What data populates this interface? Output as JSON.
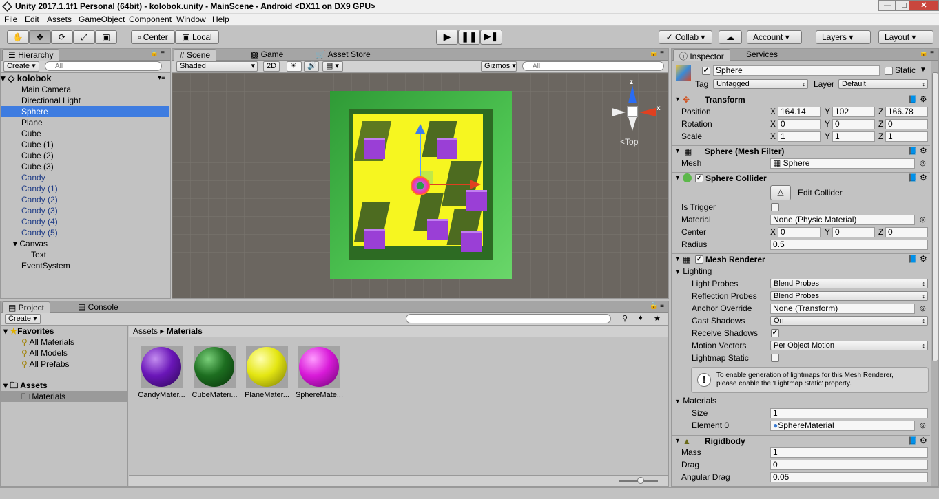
{
  "window": {
    "title": "Unity 2017.1.1f1 Personal (64bit) - kolobok.unity - MainScene - Android <DX11 on DX9 GPU>"
  },
  "menu": [
    "File",
    "Edit",
    "Assets",
    "GameObject",
    "Component",
    "Window",
    "Help"
  ],
  "toolbar": {
    "pivot": "Center",
    "space": "Local",
    "collab": "Collab",
    "account": "Account",
    "layers": "Layers",
    "layout": "Layout"
  },
  "hierarchy": {
    "tab": "Hierarchy",
    "create": "Create",
    "search_placeholder": "All",
    "scene": "kolobok",
    "items": [
      "Main Camera",
      "Directional Light",
      "Sphere",
      "Plane",
      "Cube",
      "Cube (1)",
      "Cube (2)",
      "Cube (3)",
      "Candy",
      "Candy (1)",
      "Candy (2)",
      "Candy (3)",
      "Candy (4)",
      "Candy (5)",
      "Canvas",
      "Text",
      "EventSystem"
    ]
  },
  "scene_view": {
    "tabs": [
      "Scene",
      "Game",
      "Asset Store"
    ],
    "shading": "Shaded",
    "mode2d": "2D",
    "gizmos": "Gizmos",
    "search_placeholder": "All",
    "gizmo_label": "Top",
    "axis_x": "x",
    "axis_z": "z"
  },
  "project": {
    "tabs": [
      "Project",
      "Console"
    ],
    "create": "Create",
    "favorites": "Favorites",
    "favorite_items": [
      "All Materials",
      "All Models",
      "All Prefabs"
    ],
    "assets": "Assets",
    "folders": [
      "Materials"
    ],
    "breadcrumb_root": "Assets",
    "breadcrumb_current": "Materials",
    "materials": [
      {
        "name": "CandyMater...",
        "color": "#6a16b8"
      },
      {
        "name": "CubeMateri...",
        "color": "#1d6e20"
      },
      {
        "name": "PlaneMater...",
        "color": "#e4e612"
      },
      {
        "name": "SphereMate...",
        "color": "#d81ad8"
      }
    ]
  },
  "inspector": {
    "tabs": [
      "Inspector",
      "Services"
    ],
    "object_name": "Sphere",
    "static_label": "Static",
    "tag_label": "Tag",
    "tag_value": "Untagged",
    "layer_label": "Layer",
    "layer_value": "Default",
    "transform": {
      "title": "Transform",
      "rows": [
        {
          "label": "Position",
          "x": "164.14",
          "y": "102",
          "z": "166.78"
        },
        {
          "label": "Rotation",
          "x": "0",
          "y": "0",
          "z": "0"
        },
        {
          "label": "Scale",
          "x": "1",
          "y": "1",
          "z": "1"
        }
      ]
    },
    "mesh_filter": {
      "title": "Sphere (Mesh Filter)",
      "mesh_label": "Mesh",
      "mesh_value": "Sphere"
    },
    "sphere_collider": {
      "title": "Sphere Collider",
      "edit_collider": "Edit Collider",
      "is_trigger": "Is Trigger",
      "material_label": "Material",
      "material_value": "None (Physic Material)",
      "center_label": "Center",
      "cx": "0",
      "cy": "0",
      "cz": "0",
      "radius_label": "Radius",
      "radius_value": "0.5"
    },
    "mesh_renderer": {
      "title": "Mesh Renderer",
      "lighting": "Lighting",
      "light_probes_label": "Light Probes",
      "light_probes_value": "Blend Probes",
      "reflection_probes_label": "Reflection Probes",
      "reflection_probes_value": "Blend Probes",
      "anchor_label": "Anchor Override",
      "anchor_value": "None (Transform)",
      "cast_shadows_label": "Cast Shadows",
      "cast_shadows_value": "On",
      "receive_shadows_label": "Receive Shadows",
      "motion_vectors_label": "Motion Vectors",
      "motion_vectors_value": "Per Object Motion",
      "lightmap_static_label": "Lightmap Static",
      "info_line1": "To enable generation of lightmaps for this Mesh Renderer,",
      "info_line2": "please enable the 'Lightmap Static' property.",
      "materials_label": "Materials",
      "size_label": "Size",
      "size_value": "1",
      "element0_label": "Element 0",
      "element0_value": "SphereMaterial"
    },
    "rigidbody": {
      "title": "Rigidbody",
      "mass_label": "Mass",
      "mass_value": "1",
      "drag_label": "Drag",
      "drag_value": "0",
      "angular_drag_label": "Angular Drag",
      "angular_drag_value": "0.05"
    }
  },
  "axis_letters": {
    "x": "X",
    "y": "Y",
    "z": "Z"
  }
}
